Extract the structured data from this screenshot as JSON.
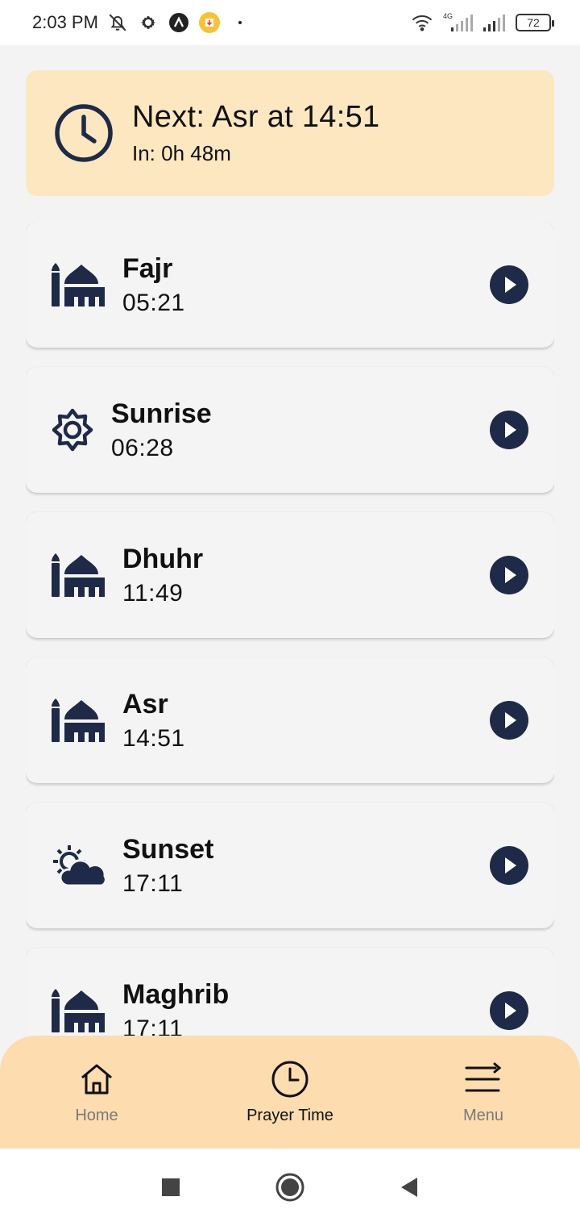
{
  "status_bar": {
    "time": "2:03 PM",
    "battery": "72",
    "network": "4G"
  },
  "next_prayer": {
    "title": "Next: Asr at 14:51",
    "countdown": "In: 0h 48m"
  },
  "prayers": [
    {
      "name": "Fajr",
      "time": "05:21",
      "icon": "mosque-icon"
    },
    {
      "name": "Sunrise",
      "time": "06:28",
      "icon": "sun-gear-icon"
    },
    {
      "name": "Dhuhr",
      "time": "11:49",
      "icon": "mosque-icon"
    },
    {
      "name": "Asr",
      "time": "14:51",
      "icon": "mosque-icon"
    },
    {
      "name": "Sunset",
      "time": "17:11",
      "icon": "cloud-sun-icon"
    },
    {
      "name": "Maghrib",
      "time": "17:11",
      "icon": "mosque-icon"
    }
  ],
  "bottom_nav": {
    "home_label": "Home",
    "prayer_time_label": "Prayer Time",
    "menu_label": "Menu"
  },
  "colors": {
    "banner_bg": "#fde7c1",
    "nav_bg": "#fddcaf",
    "icon_navy": "#1e2a47",
    "card_bg": "#f4f4f4"
  }
}
